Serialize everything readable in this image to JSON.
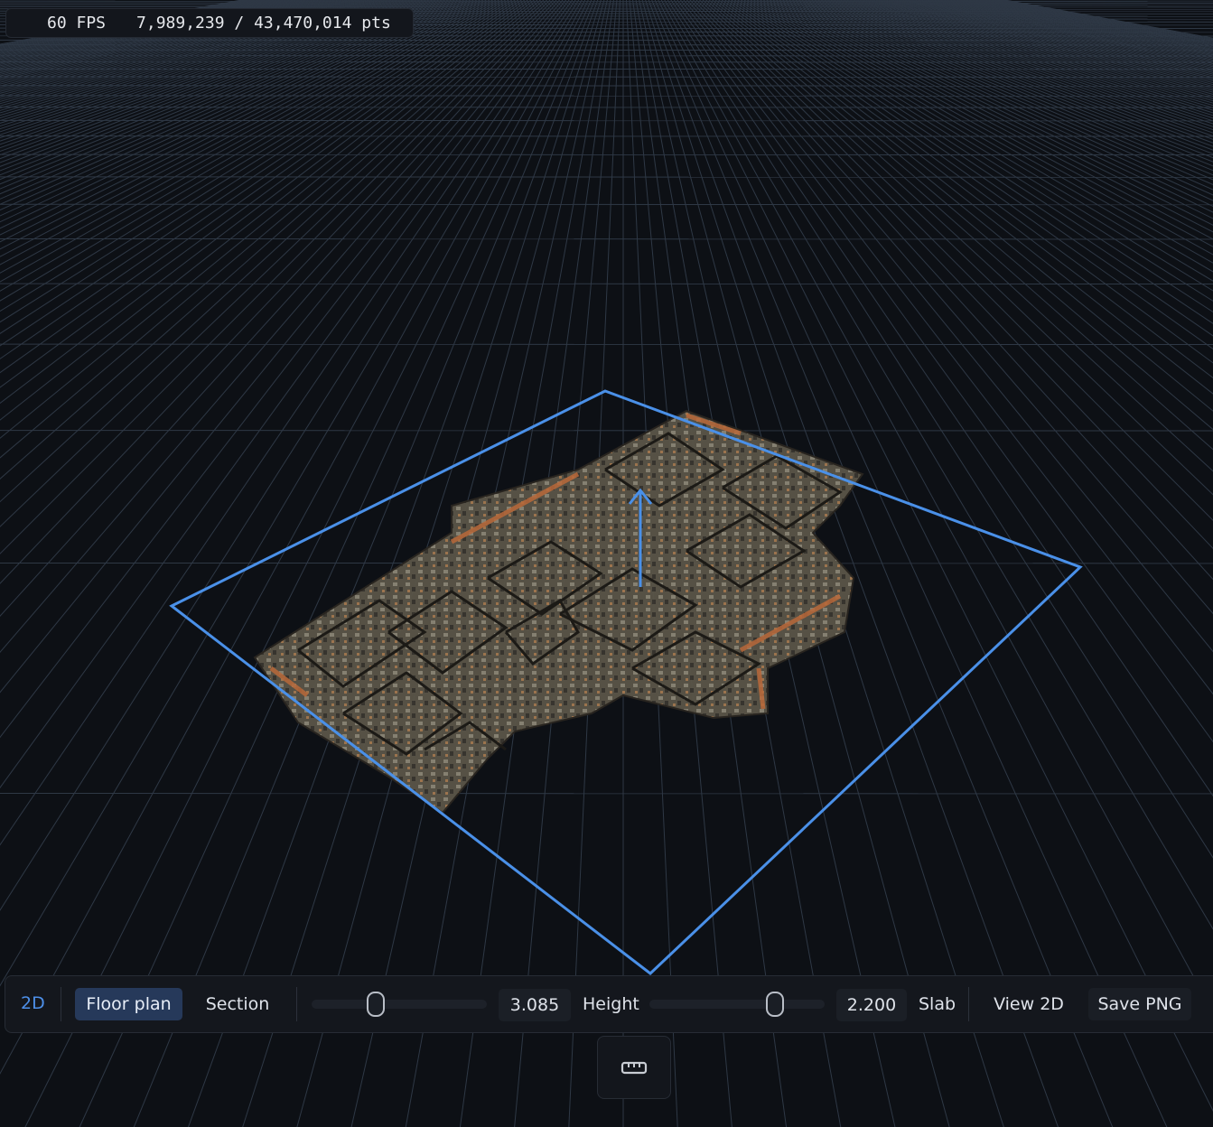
{
  "stats": {
    "fps": "60 FPS",
    "points": "7,989,239 / 43,470,014 pts"
  },
  "toolbar": {
    "mode_label": "2D",
    "floor_plan_label": "Floor plan",
    "section_label": "Section",
    "height_value": "3.085",
    "height_label": "Height",
    "height_slider_fraction": 0.35,
    "slab_value": "2.200",
    "slab_label": "Slab",
    "slab_slider_fraction": 0.7,
    "view2d_label": "View 2D",
    "save_png_label": "Save PNG"
  },
  "icons": {
    "measure": "ruler-icon"
  },
  "colors": {
    "accent": "#4d8fe8",
    "bbox": "#4a90e8",
    "background": "#0d1015"
  }
}
